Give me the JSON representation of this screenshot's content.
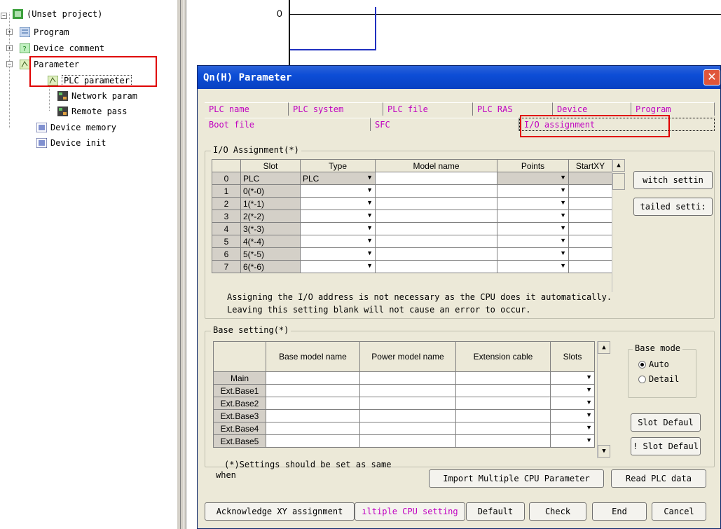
{
  "tree": {
    "root": "(Unset project)",
    "items": [
      {
        "label": "Program"
      },
      {
        "label": "Device comment"
      },
      {
        "label": "Parameter"
      },
      {
        "label": "PLC parameter"
      },
      {
        "label": "Network param"
      },
      {
        "label": "Remote pass"
      },
      {
        "label": "Device memory"
      },
      {
        "label": "Device init"
      }
    ]
  },
  "ladder": {
    "step": "0"
  },
  "dialog": {
    "title": "Qn(H) Parameter",
    "close": "✕",
    "tabs_row1": [
      "PLC name",
      "PLC system",
      "PLC file",
      "PLC RAS",
      "Device",
      "Program"
    ],
    "tabs_row2": [
      "Boot file",
      "SFC",
      "I/O assignment"
    ],
    "io": {
      "title": "I/O Assignment(*)",
      "headers": [
        "Slot",
        "Type",
        "Model name",
        "Points",
        "StartXY"
      ],
      "rows": [
        {
          "n": "0",
          "slot": "PLC",
          "type": "PLC"
        },
        {
          "n": "1",
          "slot": "0(*-0)",
          "type": ""
        },
        {
          "n": "2",
          "slot": "1(*-1)",
          "type": ""
        },
        {
          "n": "3",
          "slot": "2(*-2)",
          "type": ""
        },
        {
          "n": "4",
          "slot": "3(*-3)",
          "type": ""
        },
        {
          "n": "5",
          "slot": "4(*-4)",
          "type": ""
        },
        {
          "n": "6",
          "slot": "5(*-5)",
          "type": ""
        },
        {
          "n": "7",
          "slot": "6(*-6)",
          "type": ""
        }
      ],
      "note1": "Assigning the I/O address is not necessary as the CPU does it automatically.",
      "note2": "Leaving this setting blank will not cause an error to occur.",
      "btn_switch": "witch settin",
      "btn_detailed": "tailed setti:"
    },
    "base": {
      "title": "Base setting(*)",
      "headers": [
        "Base model name",
        "Power model name",
        "Extension cable",
        "Slots"
      ],
      "rows": [
        "Main",
        "Ext.Base1",
        "Ext.Base2",
        "Ext.Base3",
        "Ext.Base4",
        "Ext.Base5"
      ],
      "mode_title": "Base mode",
      "mode_auto": "Auto",
      "mode_detail": "Detail",
      "btn_slot1": "Slot Defaul",
      "btn_slot2": "! Slot Defaul"
    },
    "footnote1": "(*)Settings should be set as same",
    "footnote2": "when",
    "btn_import": "Import Multiple CPU Parameter",
    "btn_read": "Read PLC data",
    "btn_ack": "Acknowledge XY assignment",
    "btn_multi": "ıltiple CPU setting",
    "btn_default": "Default",
    "btn_check": "Check",
    "btn_end": "End",
    "btn_cancel": "Cancel"
  },
  "colors": {
    "tab_text": "#c000c0",
    "highlight": "#e00000",
    "title_bar": "#0841c2"
  }
}
